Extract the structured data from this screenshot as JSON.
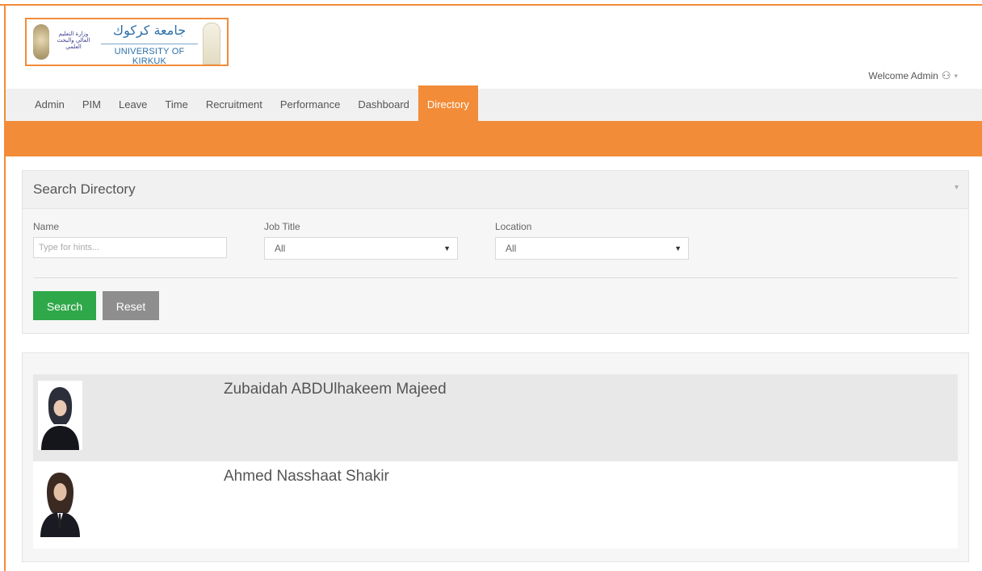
{
  "header": {
    "logo": {
      "arabic_name": "جامعة كركوك",
      "english_name": "UNIVERSITY OF KIRKUK",
      "ministry_text": "وزارة التعليم العالي والبحث العلمي"
    },
    "welcome_text": "Welcome Admin",
    "user_icon": "user-icon",
    "caret_icon": "▾"
  },
  "nav": {
    "items": [
      {
        "label": "Admin"
      },
      {
        "label": "PIM"
      },
      {
        "label": "Leave"
      },
      {
        "label": "Time"
      },
      {
        "label": "Recruitment"
      },
      {
        "label": "Performance"
      },
      {
        "label": "Dashboard"
      },
      {
        "label": "Directory",
        "active": true
      }
    ]
  },
  "search": {
    "title": "Search Directory",
    "toggle_icon": "▾",
    "name": {
      "label": "Name",
      "placeholder": "Type for hints..."
    },
    "job_title": {
      "label": "Job Title",
      "value": "All"
    },
    "location": {
      "label": "Location",
      "value": "All"
    },
    "search_button": "Search",
    "reset_button": "Reset"
  },
  "results": [
    {
      "name": "Zubaidah ABDUlhakeem Majeed"
    },
    {
      "name": "Ahmed Nasshaat Shakir"
    }
  ],
  "colors": {
    "accent": "#f28c38",
    "search_button": "#2fa84a",
    "reset_button": "#8e8e8e"
  }
}
